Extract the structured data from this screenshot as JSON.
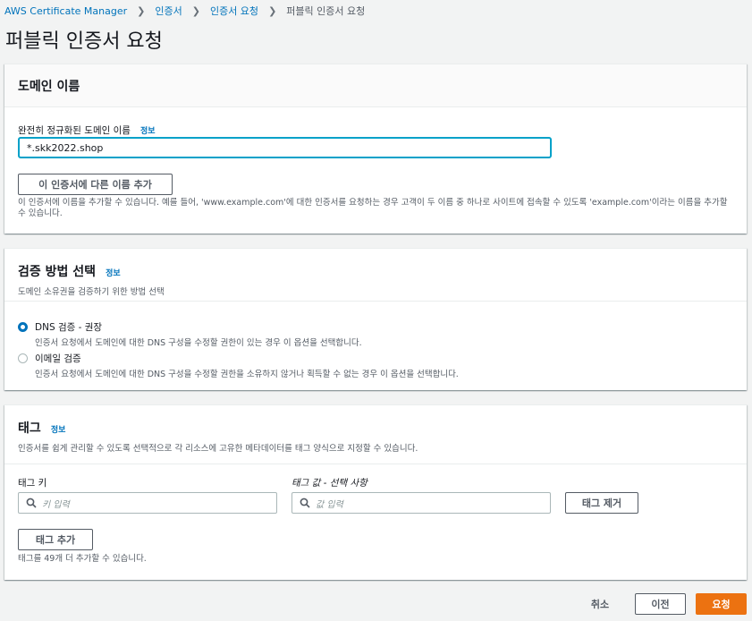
{
  "breadcrumb": {
    "items": [
      "AWS Certificate Manager",
      "인증서",
      "인증서 요청"
    ],
    "current": "퍼블릭 인증서 요청"
  },
  "page": {
    "title": "퍼블릭 인증서 요청"
  },
  "domain_panel": {
    "title": "도메인 이름",
    "field_label": "완전히 정규화된 도메인 이름",
    "info": "정보",
    "input_value": "*.skk2022.shop",
    "add_button": "이 인증서에 다른 이름 추가",
    "help_text": "이 인증서에 이름을 추가할 수 있습니다. 예를 들어, 'www.example.com'에 대한 인증서를 요청하는 경우 고객이 두 이름 중 하나로 사이트에 접속할 수 있도록 'example.com'이라는 이름을 추가할 수 있습니다."
  },
  "validation_panel": {
    "title": "검증 방법 선택",
    "info": "정보",
    "description": "도메인 소유권을 검증하기 위한 방법 선택",
    "options": [
      {
        "label": "DNS 검증 - 권장",
        "description": "인증서 요청에서 도메인에 대한 DNS 구성을 수정할 권한이 있는 경우 이 옵션을 선택합니다.",
        "checked": true
      },
      {
        "label": "이메일 검증",
        "description": "인증서 요청에서 도메인에 대한 DNS 구성을 수정할 권한을 소유하지 않거나 획득할 수 없는 경우 이 옵션을 선택합니다.",
        "checked": false
      }
    ]
  },
  "tags_panel": {
    "title": "태그",
    "info": "정보",
    "description": "인증서를 쉽게 관리할 수 있도록 선택적으로 각 리소스에 고유한 메타데이터를 태그 양식으로 지정할 수 있습니다.",
    "key_label": "태그 키",
    "value_label": "태그 값 - 선택 사항",
    "key_placeholder": "키 입력",
    "value_placeholder": "값 입력",
    "remove_button": "태그 제거",
    "add_button": "태그 추가",
    "remaining_text": "태그를 49개 더 추가할 수 있습니다."
  },
  "footer": {
    "cancel": "취소",
    "previous": "이전",
    "submit": "요청"
  },
  "colors": {
    "link": "#0073bb",
    "primary": "#ec7211",
    "focus": "#00a1c9"
  }
}
